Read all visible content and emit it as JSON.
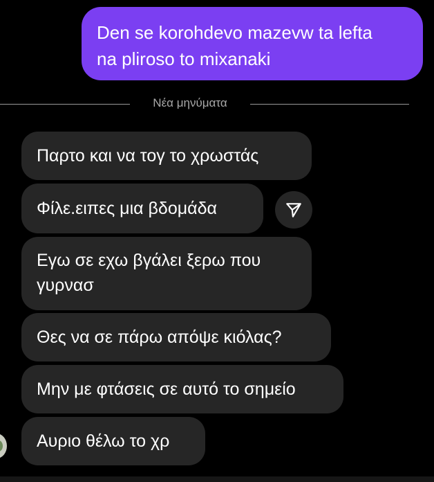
{
  "sent_message": {
    "lines": [
      "Den se korohdevo mazevw ta lefta",
      "na pliroso to mixanaki"
    ]
  },
  "divider": {
    "label": "Νέα μηνύματα"
  },
  "received_messages": [
    {
      "text": "Παρτο και να τογ το χρωστάς"
    },
    {
      "text": "Φίλε.ειπες μια βδομάδα"
    },
    {
      "lines": [
        "Εγω σε εχω βγάλει ξερω που",
        "γυρνασ"
      ]
    },
    {
      "text": "Θες να σε πάρω απόψε κιόλας?"
    },
    {
      "text": "Μην με φτάσεις σε αυτό το σημείο"
    },
    {
      "text": "Αυριο θέλω το χρ"
    }
  ],
  "share_icon": "paper-plane-icon",
  "colors": {
    "background": "#000000",
    "sent_bubble": "#7b3ff2",
    "received_bubble": "#262626",
    "divider_text": "#a8a8a8"
  }
}
